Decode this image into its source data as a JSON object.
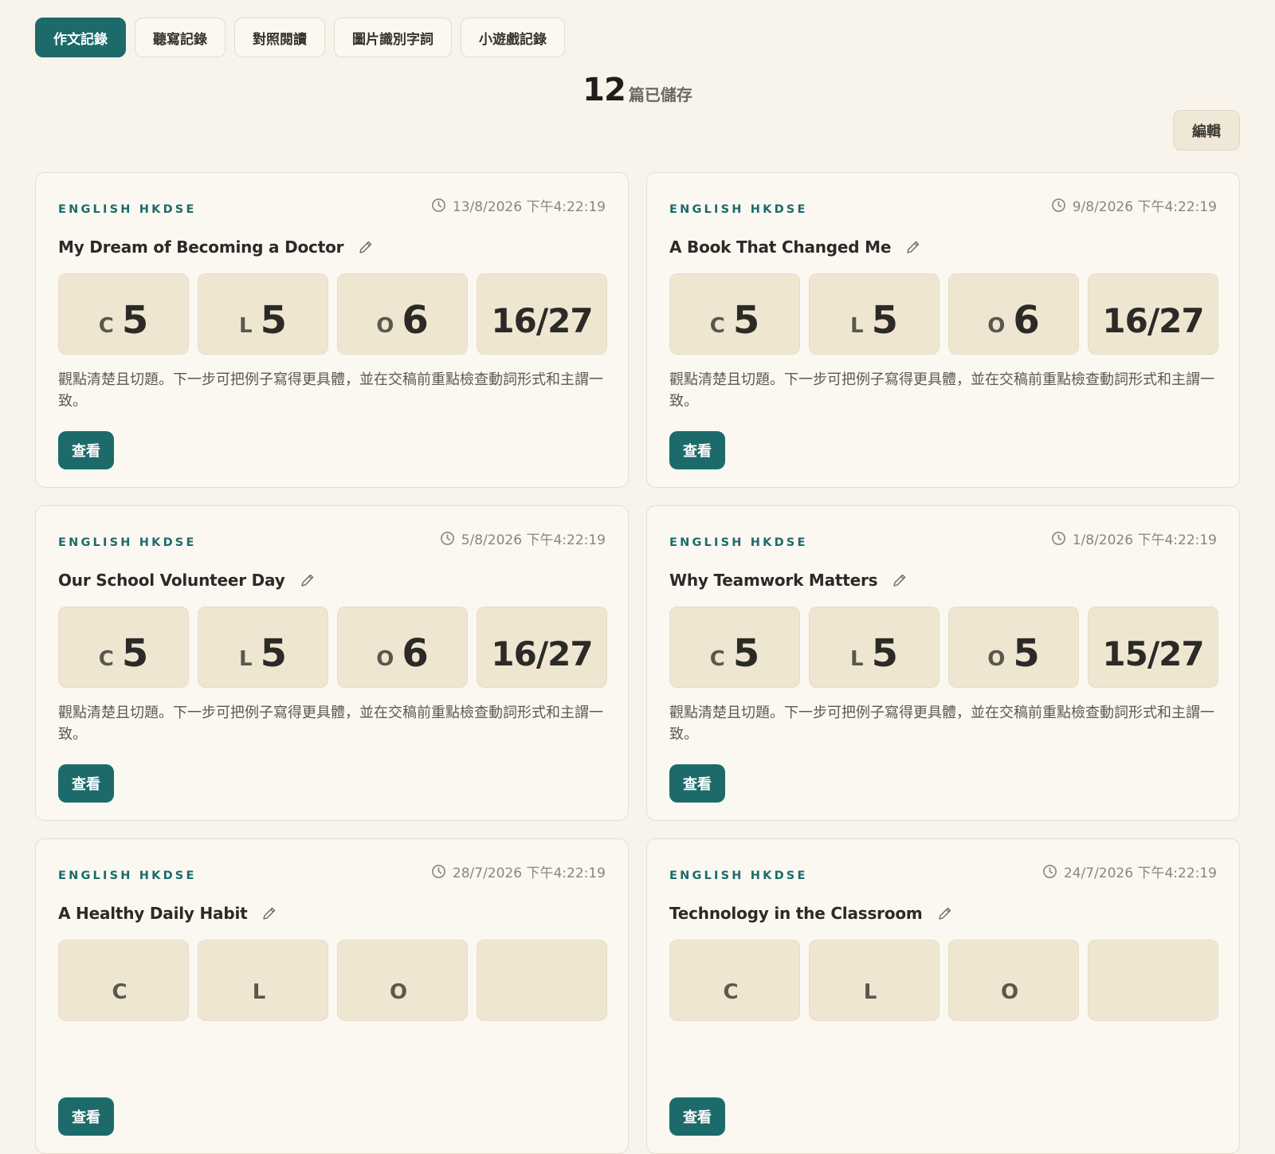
{
  "tabs": [
    {
      "label": "作文記錄",
      "active": true
    },
    {
      "label": "聽寫記錄",
      "active": false
    },
    {
      "label": "對照閱讀",
      "active": false
    },
    {
      "label": "圖片識別字詞",
      "active": false
    },
    {
      "label": "小遊戲記錄",
      "active": false
    }
  ],
  "summary": {
    "count": "12",
    "label": "篇已儲存"
  },
  "edit_label": "編輯",
  "view_label": "查看",
  "cards": [
    {
      "subject": "ENGLISH HKDSE",
      "time": "13/8/2026 下午4:22:19",
      "title": "My Dream of Becoming a Doctor",
      "scores": {
        "c_letter": "C",
        "c": "5",
        "l_letter": "L",
        "l": "5",
        "o_letter": "O",
        "o": "6",
        "total": "16/27"
      },
      "comment": "觀點清楚且切題。下一步可把例子寫得更具體，並在交稿前重點檢查動詞形式和主謂一致。"
    },
    {
      "subject": "ENGLISH HKDSE",
      "time": "9/8/2026 下午4:22:19",
      "title": "A Book That Changed Me",
      "scores": {
        "c_letter": "C",
        "c": "5",
        "l_letter": "L",
        "l": "5",
        "o_letter": "O",
        "o": "6",
        "total": "16/27"
      },
      "comment": "觀點清楚且切題。下一步可把例子寫得更具體，並在交稿前重點檢查動詞形式和主謂一致。"
    },
    {
      "subject": "ENGLISH HKDSE",
      "time": "5/8/2026 下午4:22:19",
      "title": "Our School Volunteer Day",
      "scores": {
        "c_letter": "C",
        "c": "5",
        "l_letter": "L",
        "l": "5",
        "o_letter": "O",
        "o": "6",
        "total": "16/27"
      },
      "comment": "觀點清楚且切題。下一步可把例子寫得更具體，並在交稿前重點檢查動詞形式和主謂一致。"
    },
    {
      "subject": "ENGLISH HKDSE",
      "time": "1/8/2026 下午4:22:19",
      "title": "Why Teamwork Matters",
      "scores": {
        "c_letter": "C",
        "c": "5",
        "l_letter": "L",
        "l": "5",
        "o_letter": "O",
        "o": "5",
        "total": "15/27"
      },
      "comment": "觀點清楚且切題。下一步可把例子寫得更具體，並在交稿前重點檢查動詞形式和主謂一致。"
    },
    {
      "subject": "ENGLISH HKDSE",
      "time": "28/7/2026 下午4:22:19",
      "title": "A Healthy Daily Habit",
      "scores": {
        "c_letter": "C",
        "c": "",
        "l_letter": "L",
        "l": "",
        "o_letter": "O",
        "o": "",
        "total": ""
      },
      "comment": ""
    },
    {
      "subject": "ENGLISH HKDSE",
      "time": "24/7/2026 下午4:22:19",
      "title": "Technology in the Classroom",
      "scores": {
        "c_letter": "C",
        "c": "",
        "l_letter": "L",
        "l": "",
        "o_letter": "O",
        "o": "",
        "total": ""
      },
      "comment": ""
    }
  ],
  "colors": {
    "accent": "#1c6b6a",
    "background": "#f8f4ec",
    "score_tile": "#efe6d2"
  },
  "icons": {
    "time": "clock-icon",
    "edit_title": "pencil-icon"
  }
}
